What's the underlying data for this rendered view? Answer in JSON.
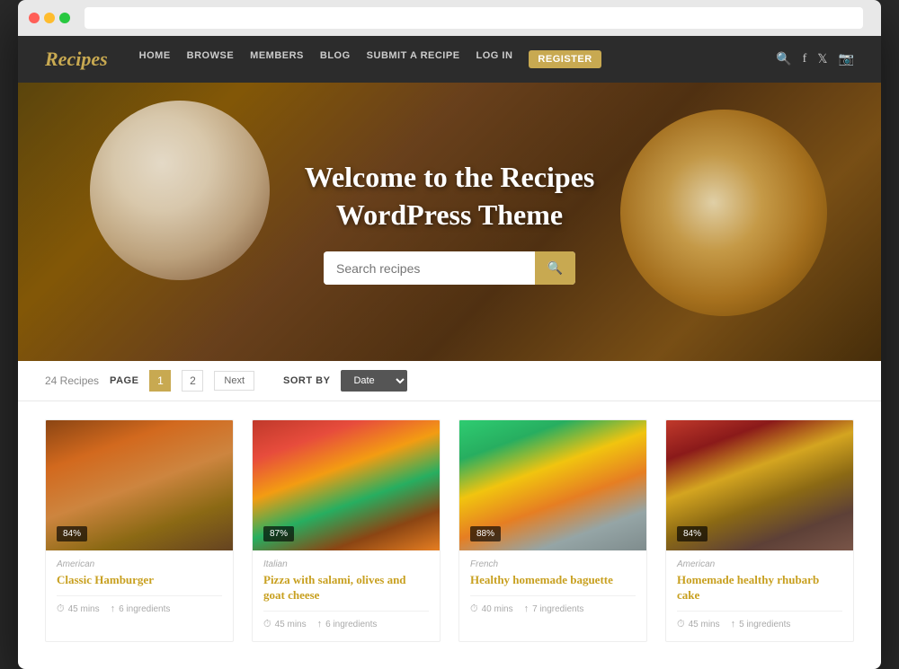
{
  "browser": {
    "dots": [
      "red",
      "yellow",
      "green"
    ]
  },
  "header": {
    "logo": "Recipes",
    "nav": [
      {
        "label": "HOME",
        "active": false
      },
      {
        "label": "BROWSE",
        "active": false
      },
      {
        "label": "MEMBERS",
        "active": false
      },
      {
        "label": "BLOG",
        "active": false
      },
      {
        "label": "SUBMIT A RECIPE",
        "active": false
      },
      {
        "label": "LOG IN",
        "active": false
      },
      {
        "label": "REGISTER",
        "active": true,
        "highlight": true
      }
    ],
    "icons": [
      "🔍",
      "f",
      "t",
      "📷"
    ]
  },
  "hero": {
    "title_line1": "Welcome to the Recipes",
    "title_line2": "WordPress Theme",
    "search_placeholder": "Search recipes"
  },
  "pagination": {
    "total_label": "24 Recipes",
    "page_label": "PAGE",
    "pages": [
      "1",
      "2"
    ],
    "next_label": "Next",
    "sort_label": "SORT BY",
    "sort_option": "Date"
  },
  "recipes": [
    {
      "id": 1,
      "image_class": "img-hamburger",
      "badge": "84%",
      "category": "American",
      "name": "Classic Hamburger",
      "time": "45 mins",
      "ingredients": "6 ingredients"
    },
    {
      "id": 2,
      "image_class": "img-pizza",
      "badge": "87%",
      "category": "Italian",
      "name": "Pizza with salami, olives and goat cheese",
      "time": "45 mins",
      "ingredients": "6 ingredients"
    },
    {
      "id": 3,
      "image_class": "img-baguette",
      "badge": "88%",
      "category": "French",
      "name": "Healthy homemade baguette",
      "time": "40 mins",
      "ingredients": "7 ingredients"
    },
    {
      "id": 4,
      "image_class": "img-rhubarb",
      "badge": "84%",
      "category": "American",
      "name": "Homemade healthy rhubarb cake",
      "time": "45 mins",
      "ingredients": "5 ingredients"
    }
  ]
}
